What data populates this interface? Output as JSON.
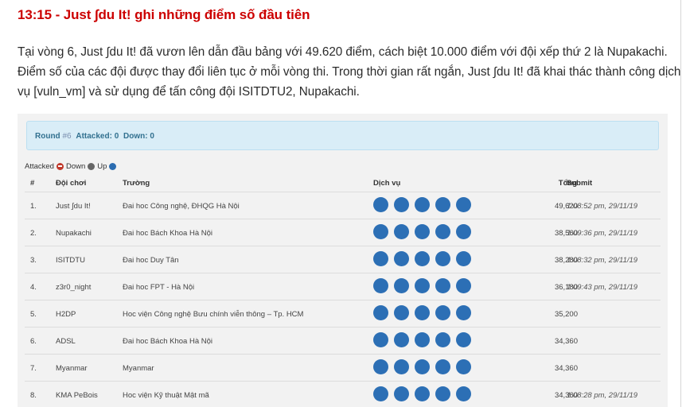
{
  "headline": "13:15 - Just ∫du It! ghi những điểm số đầu tiên",
  "article": "Tại vòng 6, Just ∫du It! đã vươn lên dẫn đầu bảng với 49.620 điểm, cách biệt 10.000 điểm với đội xếp thứ 2 là Nupakachi. Điểm số của các đội được thay đổi liên tục ở mỗi vòng thi. Trong thời gian rất ngắn, Just ∫du It! đã khai thác thành công dịch vụ [vuln_vm] và sử dụng để tấn công đội ISITDTU2, Nupakachi.",
  "round": {
    "round_label": "Round",
    "round_hash": "#6",
    "attacked_label": "Attacked:",
    "attacked_value": "0",
    "down_label": "Down:",
    "down_value": "0"
  },
  "legend": {
    "attacked": "Attacked",
    "down": "Down",
    "up": "Up"
  },
  "colors": {
    "headline": "#cc0000",
    "service_up": "#2c6fb5",
    "info_bg": "#d9edf7"
  },
  "table": {
    "headers": {
      "num": "#",
      "team": "Đội chơi",
      "school": "Trường",
      "services": "Dịch vụ",
      "score": "Tổng",
      "submit": "Submit"
    },
    "service_status": [
      "up",
      "up",
      "up",
      "up",
      "up"
    ],
    "rows": [
      {
        "num": "1.",
        "team": "Just ∫du It!",
        "school": "Đai hoc Công nghệ, ĐHQG Hà Nội",
        "score": "49,620",
        "submit": "1:08:52 pm, 29/11/19"
      },
      {
        "num": "2.",
        "team": "Nupakachi",
        "school": "Đai hoc Bách Khoa Hà Nội",
        "score": "38,560",
        "submit": "1:09:36 pm, 29/11/19"
      },
      {
        "num": "3.",
        "team": "ISITDTU",
        "school": "Đai hoc Duy Tân",
        "score": "38,280",
        "submit": "1:08:32 pm, 29/11/19"
      },
      {
        "num": "4.",
        "team": "z3r0_night",
        "school": "Đai hoc FPT - Hà Nội",
        "score": "36,180",
        "submit": "1:09:43 pm, 29/11/19"
      },
      {
        "num": "5.",
        "team": "H2DP",
        "school": "Hoc viện Công nghệ Bưu chính viễn thông – Tp. HCM",
        "score": "35,200",
        "submit": ""
      },
      {
        "num": "6.",
        "team": "ADSL",
        "school": "Đai hoc Bách Khoa Hà Nội",
        "score": "34,360",
        "submit": ""
      },
      {
        "num": "7.",
        "team": "Myanmar",
        "school": "Myanmar",
        "score": "34,360",
        "submit": ""
      },
      {
        "num": "8.",
        "team": "KMA PeBois",
        "school": "Hoc viện Kỹ thuật Mật mã",
        "score": "34,360",
        "submit": "1:08:28 pm, 29/11/19"
      }
    ]
  }
}
